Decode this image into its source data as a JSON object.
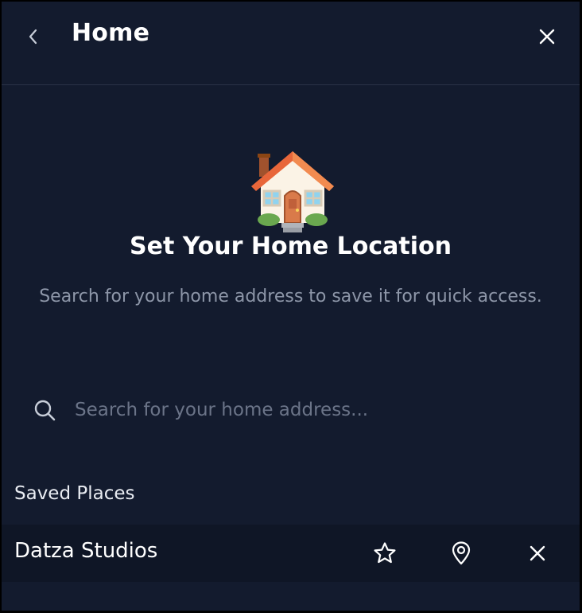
{
  "header": {
    "title": "Home",
    "back_icon": "chevron-left-icon",
    "close_icon": "close-icon"
  },
  "hero": {
    "icon": "house-icon",
    "title": "Set Your Home Location",
    "subtitle": "Search for your home address to save it for quick access."
  },
  "search": {
    "icon": "search-icon",
    "value": "",
    "placeholder": "Search for your home address..."
  },
  "saved_places": {
    "title": "Saved Places",
    "items": [
      {
        "name": "Datza Studios",
        "actions": [
          "star-icon",
          "map-pin-icon",
          "close-icon"
        ]
      }
    ]
  },
  "colors": {
    "background": "#131b2e",
    "row_background": "#0f1626",
    "divider": "#2a3347",
    "text_primary": "#ffffff",
    "text_muted": "#8d96a8",
    "placeholder": "#6b7488"
  }
}
